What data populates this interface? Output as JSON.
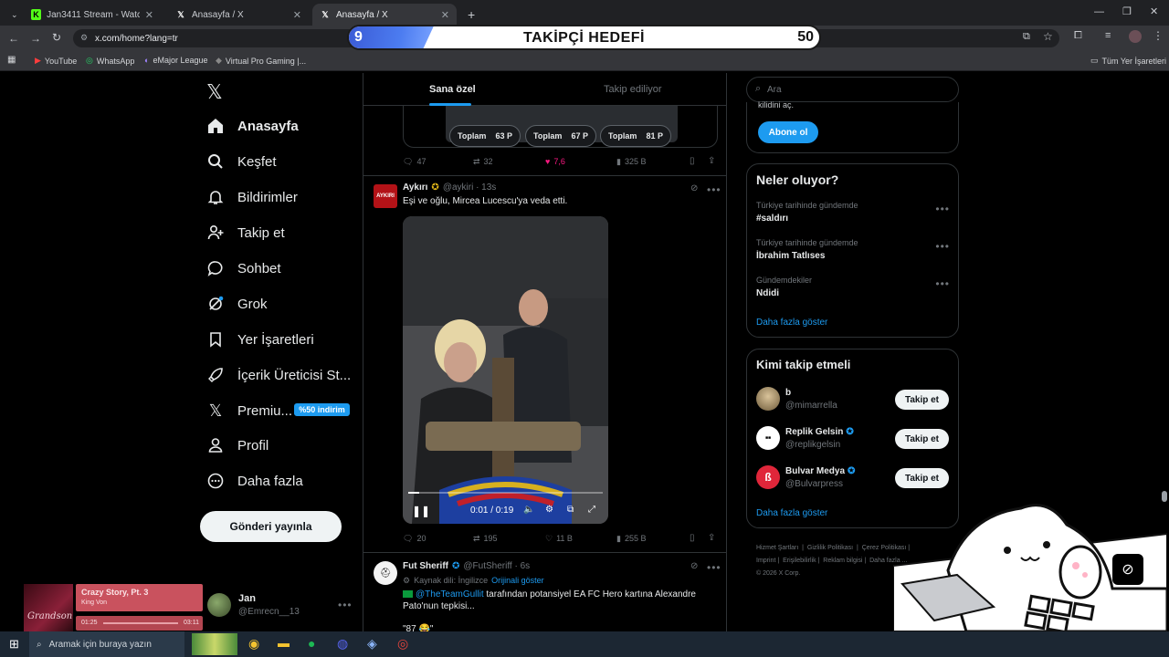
{
  "browser": {
    "tabs": [
      {
        "title": "Jan3411 Stream - Watch Live o"
      },
      {
        "title": "Anasayfa / X"
      },
      {
        "title": "Anasayfa / X"
      }
    ],
    "url": "x.com/home?lang=tr",
    "bookmarks": [
      "YouTube",
      "WhatsApp",
      "eMajor League",
      "Virtual Pro Gaming |...",
      "Tüm Yer İşaretleri"
    ]
  },
  "overlay": {
    "goal_title": "TAKİPÇİ HEDEFİ",
    "current": "9",
    "target": "50",
    "progress": 0.18
  },
  "sidebar": {
    "items": [
      {
        "label": "Anasayfa"
      },
      {
        "label": "Keşfet"
      },
      {
        "label": "Bildirimler"
      },
      {
        "label": "Takip et"
      },
      {
        "label": "Sohbet"
      },
      {
        "label": "Grok"
      },
      {
        "label": "Yer İşaretleri"
      },
      {
        "label": "İçerik Üreticisi St..."
      },
      {
        "label": "Premiu..."
      },
      {
        "label": "Profil"
      },
      {
        "label": "Daha fazla"
      }
    ],
    "premium_badge": "%50 indirim",
    "post_button": "Gönderi yayınla",
    "account": {
      "name": "Jan",
      "handle": "@Emrecn__13"
    }
  },
  "music": {
    "title": "Crazy Story, Pt. 3",
    "artist": "King Von",
    "elapsed": "01:25",
    "duration": "03:11"
  },
  "feed": {
    "tabs": [
      "Sana özel",
      "Takip ediliyor"
    ],
    "prev_post": {
      "totals": [
        {
          "label": "Toplam",
          "value": "63 P"
        },
        {
          "label": "Toplam",
          "value": "67 P"
        },
        {
          "label": "Toplam",
          "value": "81 P"
        }
      ],
      "stats": {
        "replies": "47",
        "reposts": "32",
        "likes": "7,6",
        "views": "325 B"
      }
    },
    "post1": {
      "avatar_text": "AYKIRI",
      "name": "Aykırı",
      "handle": "@aykiri · 13s",
      "text": "Eşi ve oğlu, Mircea Lucescu'ya veda etti.",
      "video_time": "0:01 / 0:19",
      "stats": {
        "replies": "20",
        "reposts": "195",
        "likes": "11 B",
        "views": "255 B"
      }
    },
    "post2": {
      "name": "Fut Sheriff",
      "handle": "@FutSheriff · 6s",
      "lang_note": "Kaynak dili: İngilizce",
      "show_original": "Orijinali göster",
      "mention": "@TheTeamGullit",
      "text": "tarafından potansiyel EA FC Hero kartına Alexandre Pato'nun tepkisi...",
      "quote": "\"87 😂\""
    }
  },
  "right": {
    "search_placeholder": "Ara",
    "subscribe_fragment": "kilidini aç.",
    "subscribe_button": "Abone ol",
    "trends_title": "Neler oluyor?",
    "trends": [
      {
        "context": "Türkiye tarihinde gündemde",
        "name": "#saldırı"
      },
      {
        "context": "Türkiye tarihinde gündemde",
        "name": "İbrahim Tatlıses"
      },
      {
        "context": "Gündemdekiler",
        "name": "Ndidi"
      }
    ],
    "show_more": "Daha fazla göster",
    "who_title": "Kimi takip etmeli",
    "who": [
      {
        "name": "b",
        "handle": "@mimarrella",
        "button": "Takip et"
      },
      {
        "name": "Replik Gelsin",
        "handle": "@replikgelsin",
        "button": "Takip et"
      },
      {
        "name": "Bulvar Medya",
        "handle": "@Bulvarpress",
        "button": "Takip et"
      }
    ],
    "footer": [
      "Hizmet Şartları",
      "Gizlilik Politikası",
      "Çerez Politikası",
      "Imprint",
      "Erişilebilirlik",
      "Reklam bilgisi",
      "Daha fazla ...",
      "© 2026 X Corp."
    ]
  },
  "taskbar": {
    "search": "Aramak için buraya yazın"
  }
}
